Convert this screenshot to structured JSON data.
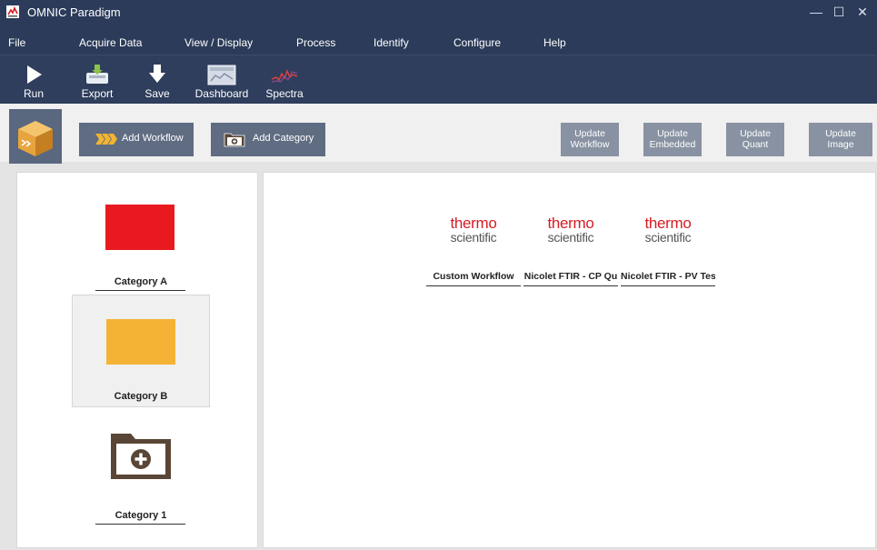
{
  "window": {
    "title": "OMNIC Paradigm",
    "minimize_glyph": "—",
    "maximize_glyph": "☐",
    "close_glyph": "✕"
  },
  "menu": {
    "items": [
      "File",
      "Acquire Data",
      "View / Display",
      "Process",
      "Identify",
      "Configure",
      "Help"
    ]
  },
  "toolbar": {
    "items": [
      {
        "label": "Run",
        "icon": "play-icon"
      },
      {
        "label": "Export",
        "icon": "export-icon"
      },
      {
        "label": "Save",
        "icon": "save-icon"
      },
      {
        "label": "Dashboard",
        "icon": "dashboard-icon"
      },
      {
        "label": "Spectra",
        "icon": "spectra-icon"
      }
    ]
  },
  "actions": {
    "add_workflow": "Add Workflow",
    "add_category": "Add Category",
    "update_workflow": [
      "Update",
      "Workflow"
    ],
    "update_embedded": [
      "Update",
      "Embedded"
    ],
    "update_quant": [
      "Update",
      "Quant"
    ],
    "update_image": [
      "Update",
      "Image"
    ]
  },
  "categories": [
    {
      "label": "Category A",
      "color": "#e8191f",
      "selected": false
    },
    {
      "label": "Category B",
      "color": "#f5b335",
      "selected": true
    },
    {
      "label": "Category 1",
      "icon": "folder-add-icon",
      "selected": false
    }
  ],
  "workflows": [
    {
      "brand_line1": "thermo",
      "brand_line2": "scientific",
      "label": "Custom Workflow"
    },
    {
      "brand_line1": "thermo",
      "brand_line2": "scientific",
      "label": "Nicolet FTIR - CP Qu"
    },
    {
      "brand_line1": "thermo",
      "brand_line2": "scientific",
      "label": "Nicolet FTIR - PV Tes"
    }
  ],
  "colors": {
    "header": "#2b3b59",
    "brand_red": "#d41c23",
    "button": "#5f6c82",
    "update_button": "#8892a2"
  }
}
